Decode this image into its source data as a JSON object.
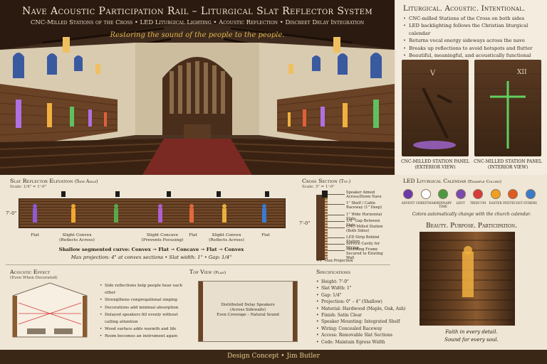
{
  "hero": {
    "title": "Nave Acoustic Participation Rail – Liturgical Slat Reflector System",
    "subtitle": "CNC-Milled Stations of the Cross • LED Liturgical Lighting • Acoustic Reflection • Discreet Delay Integration",
    "tagline": "Restoring the sound of the people to the people."
  },
  "intro": {
    "heading": "Liturgical. Acoustic. Intentional.",
    "bullets": [
      "CNC-milled Stations of the Cross on both sides",
      "LED backlighting follows the Christian liturgical calendar",
      "Returns vocal energy sideways across the nave",
      "Breaks up reflections to avoid hotspots and flutter",
      "Beautiful, meaningful, and acoustically functional"
    ],
    "panel_left_caption": "CNC-Milled Station Panel",
    "panel_left_sub": "(Exterior View)",
    "panel_left_mark": "V",
    "panel_right_caption": "CNC-Milled Station Panel",
    "panel_right_sub": "(Interior View)",
    "panel_right_mark": "XII"
  },
  "elevation": {
    "title": "Slat Reflector Elevation",
    "title_note": "(Side Aisle)",
    "scale": "Scale: 1/4\" = 1'-0\"",
    "height": "7'-0\"",
    "labels": [
      {
        "l1": "Flat",
        "l2": ""
      },
      {
        "l1": "Slight Convex",
        "l2": "(Reflects Across)"
      },
      {
        "l1": "Slight Concave",
        "l2": "(Prevents Focusing)"
      },
      {
        "l1": "Flat",
        "l2": ""
      },
      {
        "l1": "Slight Convex",
        "l2": "(Reflects Across)"
      },
      {
        "l1": "Flat",
        "l2": ""
      }
    ],
    "curve_note": "Shallow segmented curve: Convex → Flat → Concave → Flat → Convex",
    "max_note": "Max projection: 4\" at convex sections  •  Slat width: 1\"  •  Gap: 1/4\"",
    "station_colors": [
      "#8e5ad6",
      "#f0a830",
      "#5aa84a",
      "#b060d0",
      "#e06a3a",
      "#e8b040",
      "#3a7ad0"
    ]
  },
  "cross_section": {
    "title": "Cross Section",
    "title_note": "(Typ.)",
    "scale": "Scale: 3\" = 1'-0\"",
    "height": "7'-0\"",
    "labels": [
      "Speaker Aimed Across/Down Nave",
      "1\" Shelf / Cable Raceway (1\" Deep)",
      "1\" Wide Horizontal Slats",
      "1/4\" Gap Between Slats",
      "CNC-Milled Station (Both Sides)",
      "LED Strip Behind Station",
      "Service Cavity for Wiring",
      "Mounting Frame Secured to Existing Wall"
    ],
    "max_projection": "+4\" Max Projection"
  },
  "calendar": {
    "title": "LED Liturgical Calendar",
    "title_note": "(Example Colors)",
    "items": [
      {
        "name": "Advent",
        "color": "#6a3aa8"
      },
      {
        "name": "Christmas",
        "color": "#ffffff"
      },
      {
        "name": "Ordinary Time",
        "color": "#4a9a3e"
      },
      {
        "name": "Lent",
        "color": "#7a4ab0"
      },
      {
        "name": "Triduum",
        "color": "#d83a3a"
      },
      {
        "name": "Easter",
        "color": "#f0a020"
      },
      {
        "name": "Pentecost",
        "color": "#e05a20"
      },
      {
        "name": "Others",
        "color": "#3a7ac8"
      }
    ],
    "note": "Colors automatically change with the church calendar."
  },
  "beauty": {
    "title": "Beauty. Purpose. Participation.",
    "line1": "Faith in every detail.",
    "line2": "Sound for every soul."
  },
  "acoustic_effect": {
    "title": "Acoustic Effect",
    "title_note": "(Even When Decorated)",
    "bullets": [
      "Side reflections help people hear each other",
      "Strengthens congregational singing",
      "Decorations add minimal absorption",
      "Delayed speakers fill evenly without calling attention",
      "Wood surface adds warmth and life",
      "Room becomes an instrument again"
    ]
  },
  "top_view": {
    "title": "Top View",
    "title_note": "(Plan)",
    "line1": "Distributed Delay Speakers",
    "line2": "(Across Sidewalls)",
    "line3": "Even Coverage – Natural Sound"
  },
  "specs": {
    "title": "Specifications",
    "items": [
      "Height: 7'-0\"",
      "Slat Width: 1\"",
      "Gap: 1/4\"",
      "Projection: 0\" – 4\" (Shallow)",
      "Material: Hardwood (Maple, Oak, Ash)",
      "Finish: Satin Clear",
      "Speaker Mounting: Integrated Shelf",
      "Wiring: Concealed Raceway",
      "Access: Removable Slat Sections",
      "Code: Maintain Egress Width"
    ]
  },
  "footer": {
    "concept": "Design Concept",
    "separator": "•",
    "author": "Jim Butler"
  }
}
